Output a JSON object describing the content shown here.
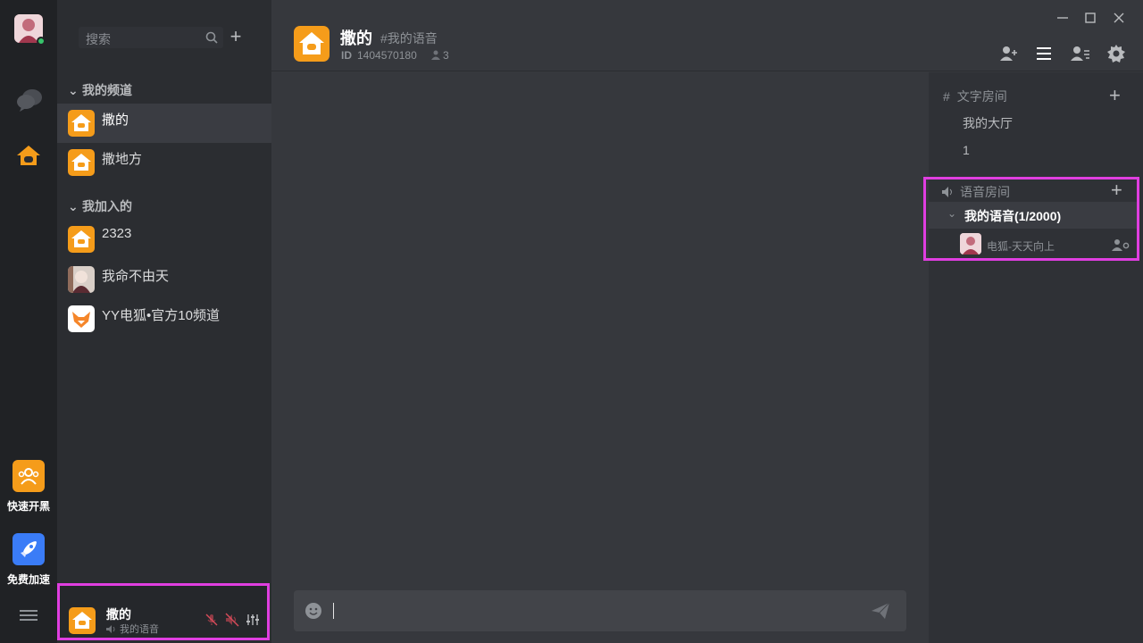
{
  "rail": {
    "quick_label": "快速开黑",
    "boost_label": "免费加速",
    "icons": [
      "avatar",
      "chat-icon",
      "home-icon",
      "users-icon",
      "rocket-icon",
      "menu-icon"
    ]
  },
  "sidebar": {
    "search_placeholder": "搜索",
    "add_label": "+",
    "my_channels_header": "我的频道",
    "my_channels": [
      {
        "name": "撒的",
        "icon": "house-icon",
        "active": true
      },
      {
        "name": "撒地方",
        "icon": "house-icon",
        "active": false
      }
    ],
    "joined_header": "我加入的",
    "joined": [
      {
        "name": "2323",
        "icon": "house-icon"
      },
      {
        "name": "我命不由天",
        "icon": "avatar"
      },
      {
        "name": "YY电狐•官方10频道",
        "icon": "fox-icon"
      }
    ]
  },
  "user_bar": {
    "name": "撒的",
    "voice": "我的语音"
  },
  "header": {
    "title": "撒的",
    "sub_channel": "#我的语音",
    "id_label": "ID",
    "id_value": "1404570180",
    "member_count": "3"
  },
  "composer": {
    "value": ""
  },
  "right_panel": {
    "text_section": "文字房间",
    "text_rooms": [
      "我的大厅",
      "1"
    ],
    "voice_section": "语音房间",
    "voice_room": "我的语音(1/2000)",
    "voice_user": "电狐-天天向上"
  },
  "colors": {
    "accent_orange": "#f59c1a",
    "highlight_magenta": "#e03ee0",
    "online_green": "#37c36b",
    "boost_blue": "#3a7cf7"
  }
}
